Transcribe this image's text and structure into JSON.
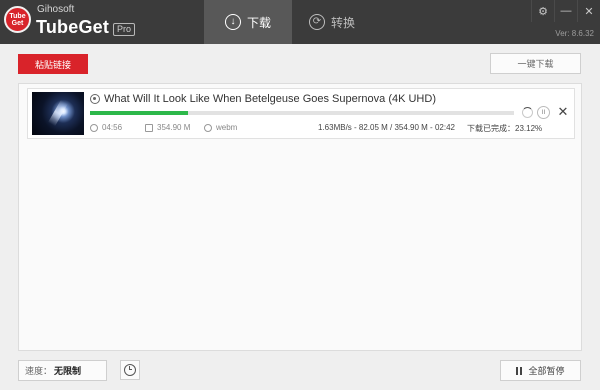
{
  "app": {
    "brand_small": "Gihosoft",
    "brand_name": "TubeGet",
    "edition": "Pro",
    "version": "Ver: 8.6.32",
    "logo_text": "Tube Get"
  },
  "tabs": [
    {
      "label": "下载",
      "icon": "download-circle-icon",
      "active": true
    },
    {
      "label": "转换",
      "icon": "convert-arrows-icon",
      "active": false
    }
  ],
  "window_controls": {
    "settings": "⚙",
    "minimize": "—",
    "close": "✕"
  },
  "toolbar": {
    "paste_label": "粘贴链接",
    "oneclick_label": "一键下载"
  },
  "downloads": [
    {
      "title": "What Will It Look Like When Betelgeuse Goes Supernova (4K UHD)",
      "duration": "04:56",
      "size": "354.90 M",
      "format": "webm",
      "progress_text": "1.63MB/s - 82.05 M / 354.90 M - 02:42",
      "percent_text": "下载已完成：23.12%",
      "progress_fraction": 0.2312,
      "pause_glyph": "II",
      "close_glyph": "✕"
    }
  ],
  "footer": {
    "speed_label": "速度：",
    "speed_value": "无限制",
    "pause_all_label": "全部暂停"
  },
  "colors": {
    "titlebar": "#3b3b3b",
    "active_tab": "#585858",
    "accent_red": "#d9232a",
    "progress_green": "#2db84a"
  }
}
